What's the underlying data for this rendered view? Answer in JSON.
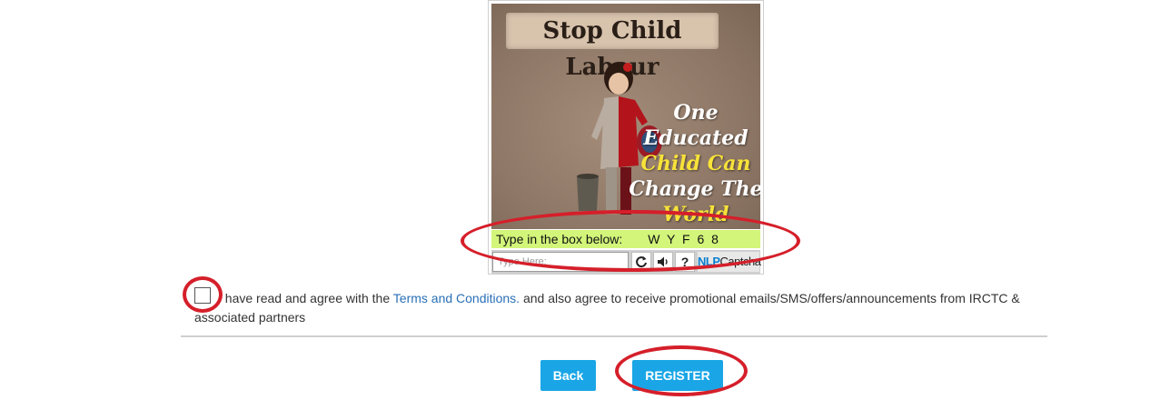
{
  "captcha": {
    "banner_title": "Stop Child Labour",
    "slogan_lines": [
      "One Educated",
      "Child Can",
      "Change The",
      "World"
    ],
    "instruction": "Type in the box below:",
    "code": "W Y F 6 8",
    "input_placeholder": "Type Here:",
    "refresh_icon": "refresh-icon",
    "audio_icon": "speaker-icon",
    "help_label": "?",
    "brand_prefix": "NLP",
    "brand_suffix": "Captcha"
  },
  "agreement": {
    "text_before": "I have read and agree with the ",
    "link_text": "Terms and Conditions.",
    "text_after": " and also agree to receive promotional emails/SMS/offers/announcements from IRCTC & associated partners"
  },
  "actions": {
    "back_label": "Back",
    "register_label": "REGISTER"
  },
  "colors": {
    "button": "#1aa6e6",
    "highlight": "#d2f57a",
    "annotation": "#d51f2a",
    "link": "#2a6fb7"
  }
}
